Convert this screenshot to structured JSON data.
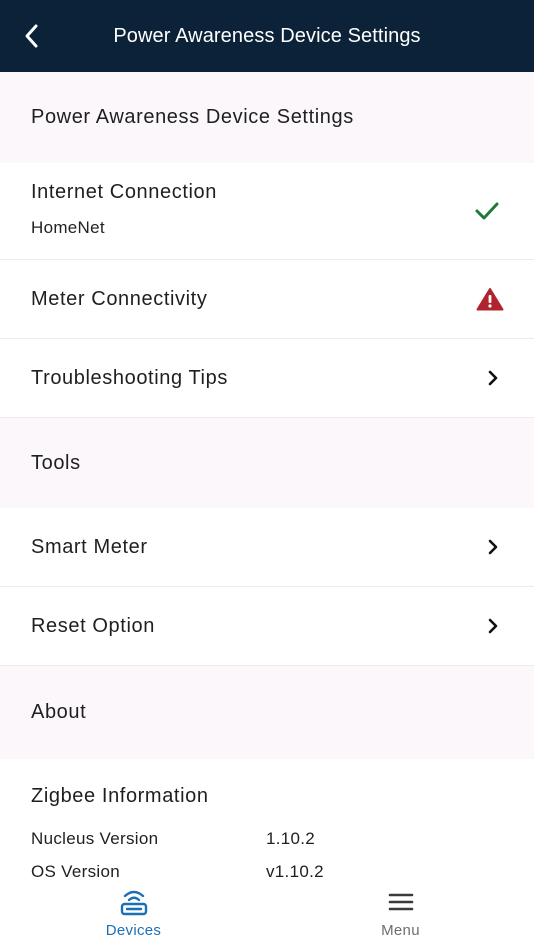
{
  "header": {
    "title": "Power Awareness Device Settings"
  },
  "sections": {
    "device_settings": "Power Awareness Device Settings",
    "tools": "Tools",
    "about": "About"
  },
  "rows": {
    "internet": {
      "label": "Internet Connection",
      "value": "HomeNet",
      "status_icon": "check-icon"
    },
    "meter": {
      "label": "Meter Connectivity",
      "status_icon": "warning-icon"
    },
    "troubleshooting": {
      "label": "Troubleshooting Tips"
    },
    "smart_meter": {
      "label": "Smart Meter"
    },
    "reset": {
      "label": "Reset Option"
    }
  },
  "zigbee": {
    "title": "Zigbee Information",
    "items": [
      {
        "key": "Nucleus Version",
        "value": "1.10.2"
      },
      {
        "key": "OS Version",
        "value": "v1.10.2"
      }
    ]
  },
  "nav": {
    "devices": "Devices",
    "menu": "Menu"
  },
  "colors": {
    "header_bg": "#0c2238",
    "section_bg": "#fcf7fb",
    "check": "#1e7a3a",
    "warning": "#b0232f",
    "active_nav": "#1c6fb5",
    "inactive_nav": "#4a4a4a"
  }
}
